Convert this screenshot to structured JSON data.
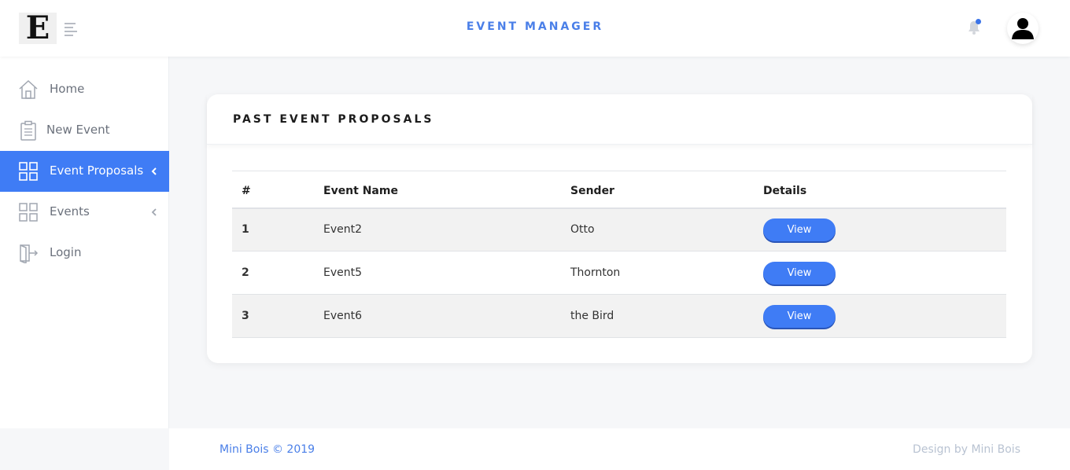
{
  "header": {
    "logo_letter": "E",
    "title": "EVENT MANAGER",
    "accent_color": "#4a7fe8",
    "icons": [
      "menu-icon",
      "bell-icon",
      "user-avatar-icon"
    ]
  },
  "sidebar": {
    "items": [
      {
        "label": "Home",
        "icon": "home-icon",
        "active": false
      },
      {
        "label": "New Event",
        "icon": "clipboard-icon",
        "active": false
      },
      {
        "label": "Event Proposals",
        "icon": "grid-icon",
        "active": true,
        "chevron": true
      },
      {
        "label": "Events",
        "icon": "grid-icon",
        "active": false,
        "chevron": true
      },
      {
        "label": "Login",
        "icon": "login-icon",
        "active": false
      }
    ]
  },
  "card": {
    "title": "PAST EVENT PROPOSALS",
    "columns": [
      "#",
      "Event Name",
      "Sender",
      "Details"
    ],
    "rows": [
      {
        "num": "1",
        "name": "Event2",
        "sender": "Otto",
        "action": "View"
      },
      {
        "num": "2",
        "name": "Event5",
        "sender": "Thornton",
        "action": "View"
      },
      {
        "num": "3",
        "name": "Event6",
        "sender": "the Bird",
        "action": "View"
      }
    ]
  },
  "footer": {
    "left": "Mini Bois © 2019",
    "right": "Design by Mini Bois"
  }
}
